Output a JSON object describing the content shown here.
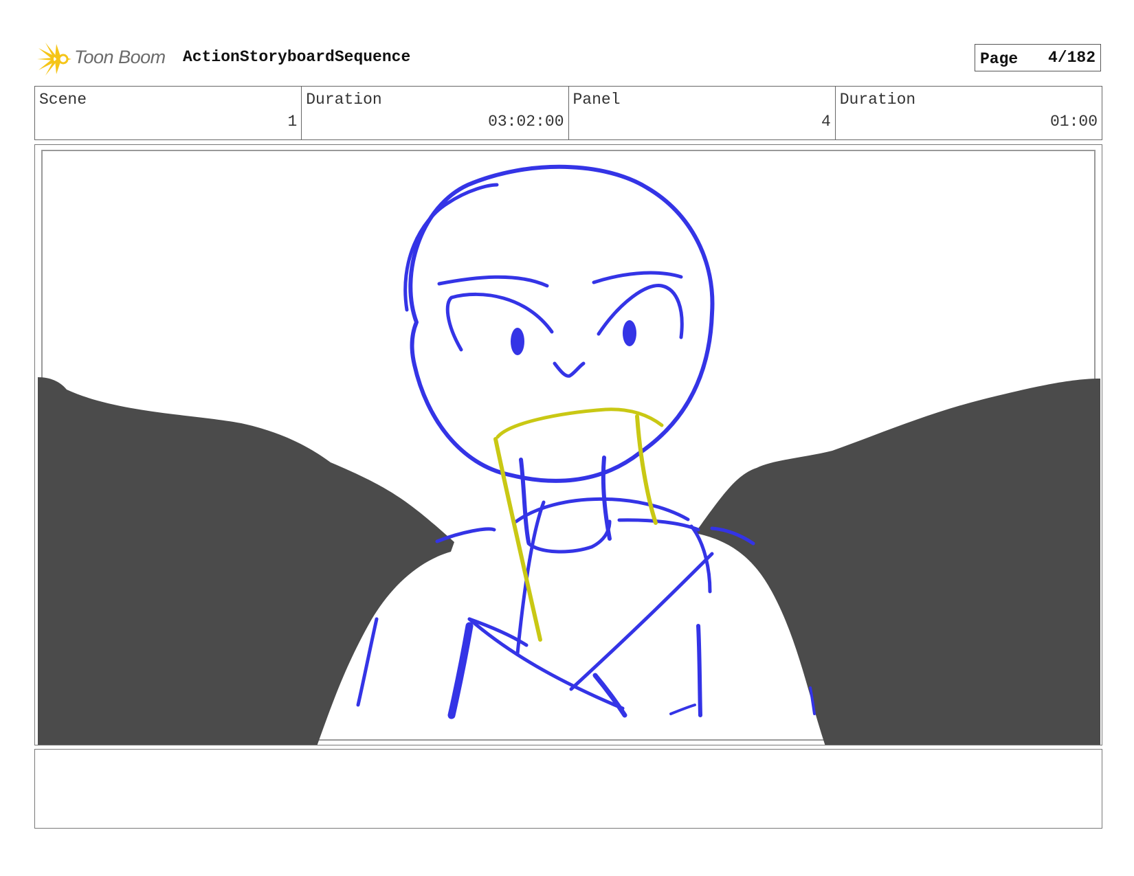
{
  "header": {
    "logo_text": "Toon Boom",
    "project_title": "ActionStoryboardSequence",
    "page_label": "Page",
    "page_number": "4/182"
  },
  "info": {
    "scene_label": "Scene",
    "scene_value": "1",
    "scene_duration_label": "Duration",
    "scene_duration_value": "03:02:00",
    "panel_label": "Panel",
    "panel_value": "4",
    "panel_duration_label": "Duration",
    "panel_duration_value": "01:00"
  },
  "colors": {
    "sketch_blue": "#3434e6",
    "sketch_yellow": "#c9c814",
    "wing_gray": "#4b4b4b",
    "logo_yellow": "#f5c518"
  },
  "icons": {
    "logo": "starburst-logo-icon"
  },
  "notes": ""
}
